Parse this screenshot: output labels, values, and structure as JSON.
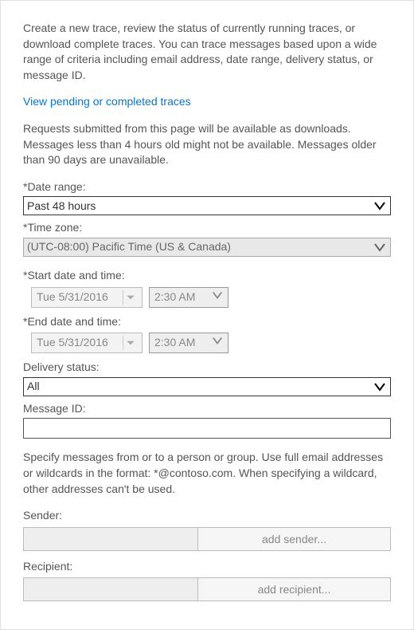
{
  "intro": "Create a new trace, review the status of currently running traces, or download complete traces. You can trace messages based upon a wide range of criteria including email address, date range, delivery status, or message ID.",
  "pending_link": "View pending or completed traces",
  "note": "Requests submitted from this page will be available as downloads. Messages less than 4 hours old might not be available. Messages older than 90 days are unavailable.",
  "labels": {
    "date_range": "*Date range:",
    "time_zone": "*Time zone:",
    "start_dt": "*Start date and time:",
    "end_dt": "*End date and time:",
    "delivery_status": "Delivery status:",
    "message_id": "Message ID:",
    "sender": "Sender:",
    "recipient": "Recipient:"
  },
  "values": {
    "date_range": "Past 48 hours",
    "time_zone": "(UTC-08:00) Pacific Time (US & Canada)",
    "start_date": "Tue 5/31/2016",
    "start_time": "2:30 AM",
    "end_date": "Tue 5/31/2016",
    "end_time": "2:30 AM",
    "delivery_status": "All",
    "message_id": ""
  },
  "wildcard_note": "Specify messages from or to a person or group. Use full email addresses or wildcards in the format: *@contoso.com. When specifying a wildcard, other addresses can't be used.",
  "buttons": {
    "add_sender": "add sender...",
    "add_recipient": "add recipient..."
  }
}
